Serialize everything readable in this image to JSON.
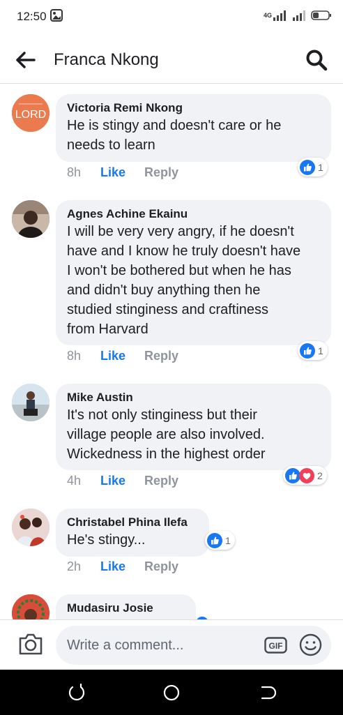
{
  "status_bar": {
    "time": "12:50",
    "network": "4G"
  },
  "header": {
    "title": "Franca Nkong"
  },
  "comments": [
    {
      "author": "Victoria Remi Nkong",
      "avatar_text": "LORD",
      "text": "He is stingy and doesn't care or he\nneeds to learn",
      "time": "8h",
      "like_label": "Like",
      "reply_label": "Reply",
      "reaction_count": "1",
      "reactions": [
        "like"
      ]
    },
    {
      "author": "Agnes Achine Ekainu",
      "text": "I will be very very angry, if he doesn't\nhave and I know he truly doesn't have\nI won't be bothered but when he has\nand didn't buy anything then he\nstudied stinginess and craftiness\nfrom Harvard",
      "time": "8h",
      "like_label": "Like",
      "reply_label": "Reply",
      "reaction_count": "1",
      "reactions": [
        "like"
      ]
    },
    {
      "author": "Mike Austin",
      "text": "It's not only stinginess but their\nvillage people are also involved.\nWickedness in the highest order",
      "time": "4h",
      "like_label": "Like",
      "reply_label": "Reply",
      "reaction_count": "2",
      "reactions": [
        "like",
        "love"
      ]
    },
    {
      "author": "Christabel Phina Ilefa",
      "text": "He's stingy...",
      "time": "2h",
      "like_label": "Like",
      "reply_label": "Reply",
      "reaction_count": "1",
      "reactions": [
        "like"
      ]
    },
    {
      "author": "Mudasiru Josie",
      "text": "",
      "time": "",
      "like_label": "",
      "reply_label": "",
      "reaction_count": "",
      "reactions": []
    }
  ],
  "composer": {
    "placeholder": "Write a comment...",
    "gif_label": "GIF"
  },
  "colors": {
    "accent": "#1877f2",
    "love": "#f33e58",
    "bubble": "#f0f2f5"
  }
}
